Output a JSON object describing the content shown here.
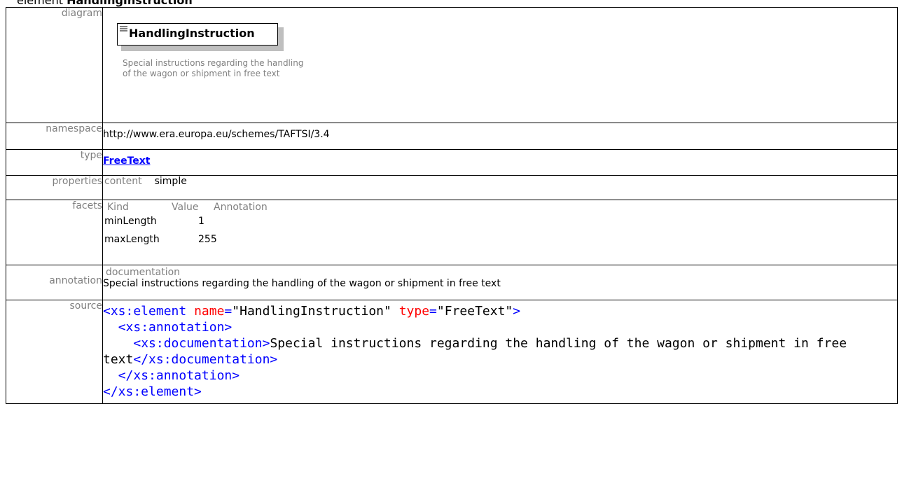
{
  "heading": {
    "prefix": "element",
    "name": "HandlingInstruction"
  },
  "labels": {
    "diagram": "diagram",
    "namespace": "namespace",
    "type": "type",
    "properties": "properties",
    "facets": "facets",
    "annotation": "annotation",
    "source": "source"
  },
  "diagram": {
    "element_name": "HandlingInstruction",
    "description": "Special instructions regarding the handling of the wagon or shipment in free text"
  },
  "namespace": "http://www.era.europa.eu/schemes/TAFTSI/3.4",
  "type": "FreeText",
  "properties": {
    "key": "content",
    "value": "simple"
  },
  "facets": {
    "headers": [
      "Kind",
      "Value",
      "Annotation"
    ],
    "rows": [
      {
        "kind": "minLength",
        "value": "1"
      },
      {
        "kind": "maxLength",
        "value": "255"
      }
    ]
  },
  "annotation": {
    "head": "documentation",
    "text": "Special instructions regarding the handling of the wagon or shipment in free text"
  },
  "source": {
    "l1_open": "<xs:element",
    "l1_attr1": "name",
    "l1_val1": "\"HandlingInstruction\"",
    "l1_attr2": "type",
    "l1_val2": "\"FreeText\"",
    "l1_close": ">",
    "l2": "<xs:annotation>",
    "l3_open": "<xs:documentation>",
    "l3_text": "Special instructions regarding the handling of the wagon or shipment in free text",
    "l3_close": "</xs:documentation>",
    "l4": "</xs:annotation>",
    "l5": "</xs:element>"
  }
}
